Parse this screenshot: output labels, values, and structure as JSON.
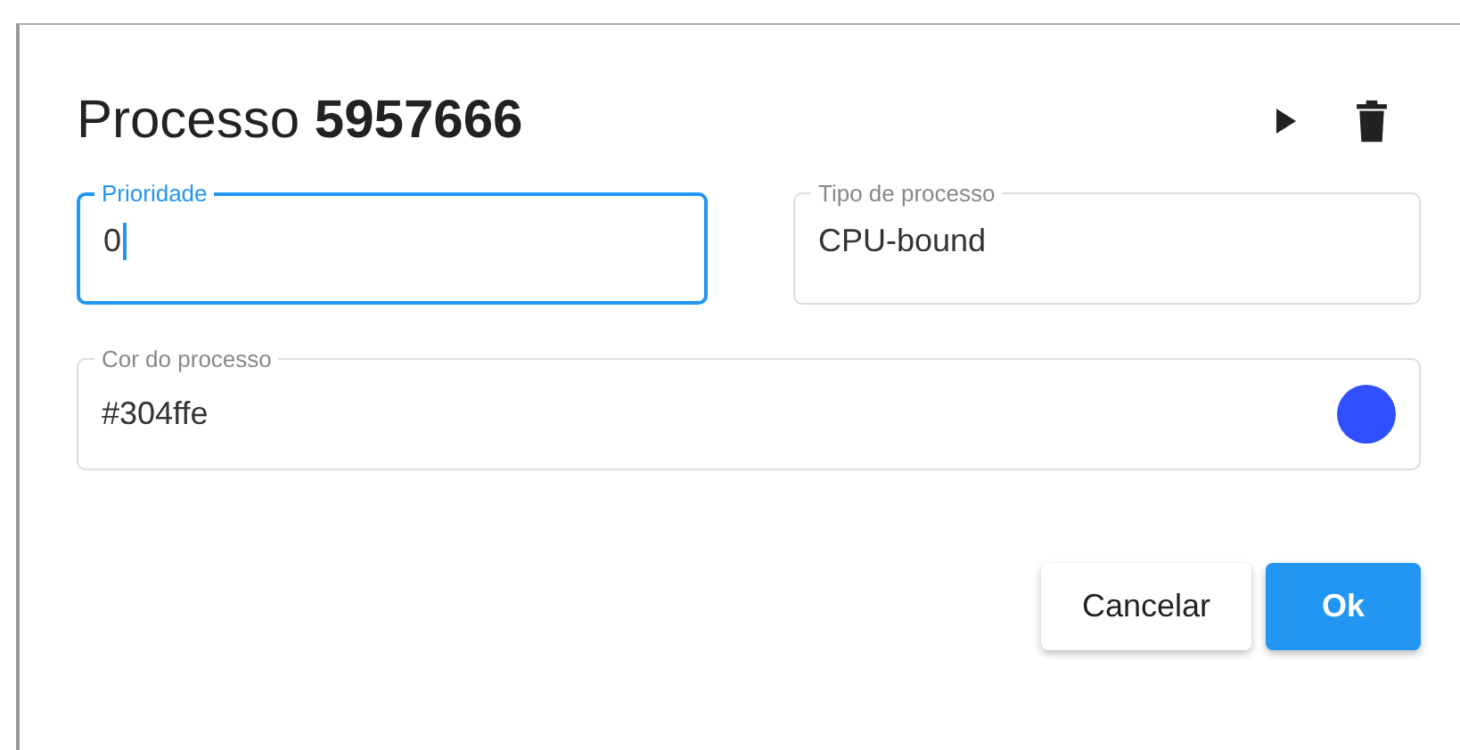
{
  "dialog": {
    "title": "Processo **5957666**",
    "actions": [
      {
        "kind": "play"
      },
      {
        "kind": "delete"
      }
    ],
    "fields": [
      {
        "label": "Prioridade",
        "value": "0",
        "focused": true
      },
      {
        "label": "Tipo de processo",
        "value": "CPU-bound",
        "focused": false
      }
    ],
    "color_field": {
      "label": "Cor do processo",
      "value": "#304ffe",
      "color": "#304ffe"
    },
    "buttons": [
      {
        "label": "Cancelar",
        "kind": "secondary"
      },
      {
        "label": "Ok",
        "kind": "primary"
      }
    ]
  }
}
